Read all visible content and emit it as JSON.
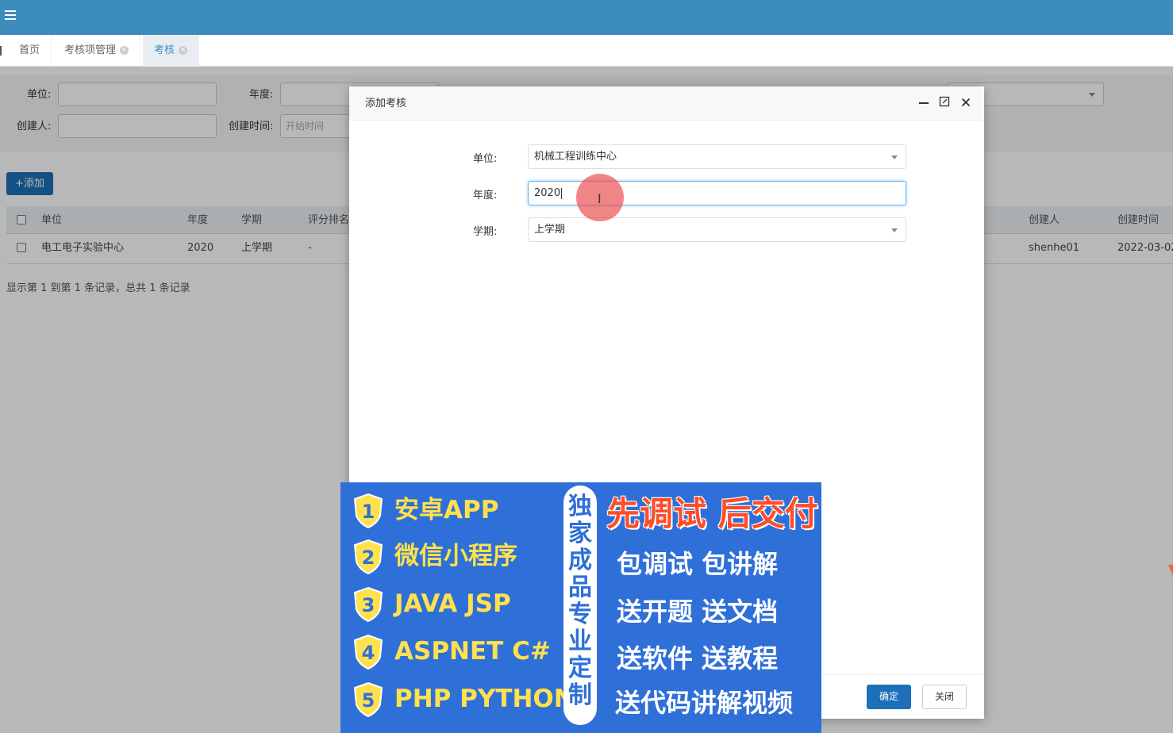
{
  "tabs": [
    {
      "label": "首页",
      "closable": false,
      "active": false
    },
    {
      "label": "考核项管理",
      "closable": true,
      "active": false
    },
    {
      "label": "考核",
      "closable": true,
      "active": true
    }
  ],
  "search": {
    "unit_label": "单位:",
    "year_label": "年度:",
    "creator_label": "创建人:",
    "created_time_label": "创建时间:",
    "start_time_placeholder": "开始时间"
  },
  "toolbar": {
    "add_label": "+添加"
  },
  "table": {
    "headers": [
      "单位",
      "年度",
      "学期",
      "评分排名",
      "创建人",
      "创建时间"
    ],
    "rows": [
      {
        "unit": "电工电子实验中心",
        "year": "2020",
        "term": "上学期",
        "rank": "-",
        "creator": "shenhe01",
        "created": "2022-03-02"
      }
    ],
    "pager": "显示第 1 到第 1 条记录，总共 1 条记录"
  },
  "dialog": {
    "title": "添加考核",
    "fields": {
      "unit_label": "单位:",
      "unit_value": "机械工程训练中心",
      "year_label": "年度:",
      "year_value": "2020",
      "term_label": "学期:",
      "term_value": "上学期"
    },
    "ok_label": "确定",
    "close_label": "关闭",
    "icons": [
      "minimize-icon",
      "maximize-icon",
      "close-icon"
    ]
  },
  "ad": {
    "items": [
      {
        "num": "1",
        "text": "安卓APP"
      },
      {
        "num": "2",
        "text": "微信小程序"
      },
      {
        "num": "3",
        "text": "JAVA JSP"
      },
      {
        "num": "4",
        "text": "ASPNET C#"
      },
      {
        "num": "5",
        "text": "PHP PYTHON"
      }
    ],
    "vertical": "独家成品专业定制",
    "headline": "先调试 后交付",
    "lines": [
      "包调试 包讲解",
      "送开题 送文档",
      "送软件 送教程",
      "送代码讲解视频"
    ],
    "colors": {
      "bg": "#2f6fd8",
      "yellow": "#ffe14d",
      "red": "#ff4d26"
    }
  }
}
